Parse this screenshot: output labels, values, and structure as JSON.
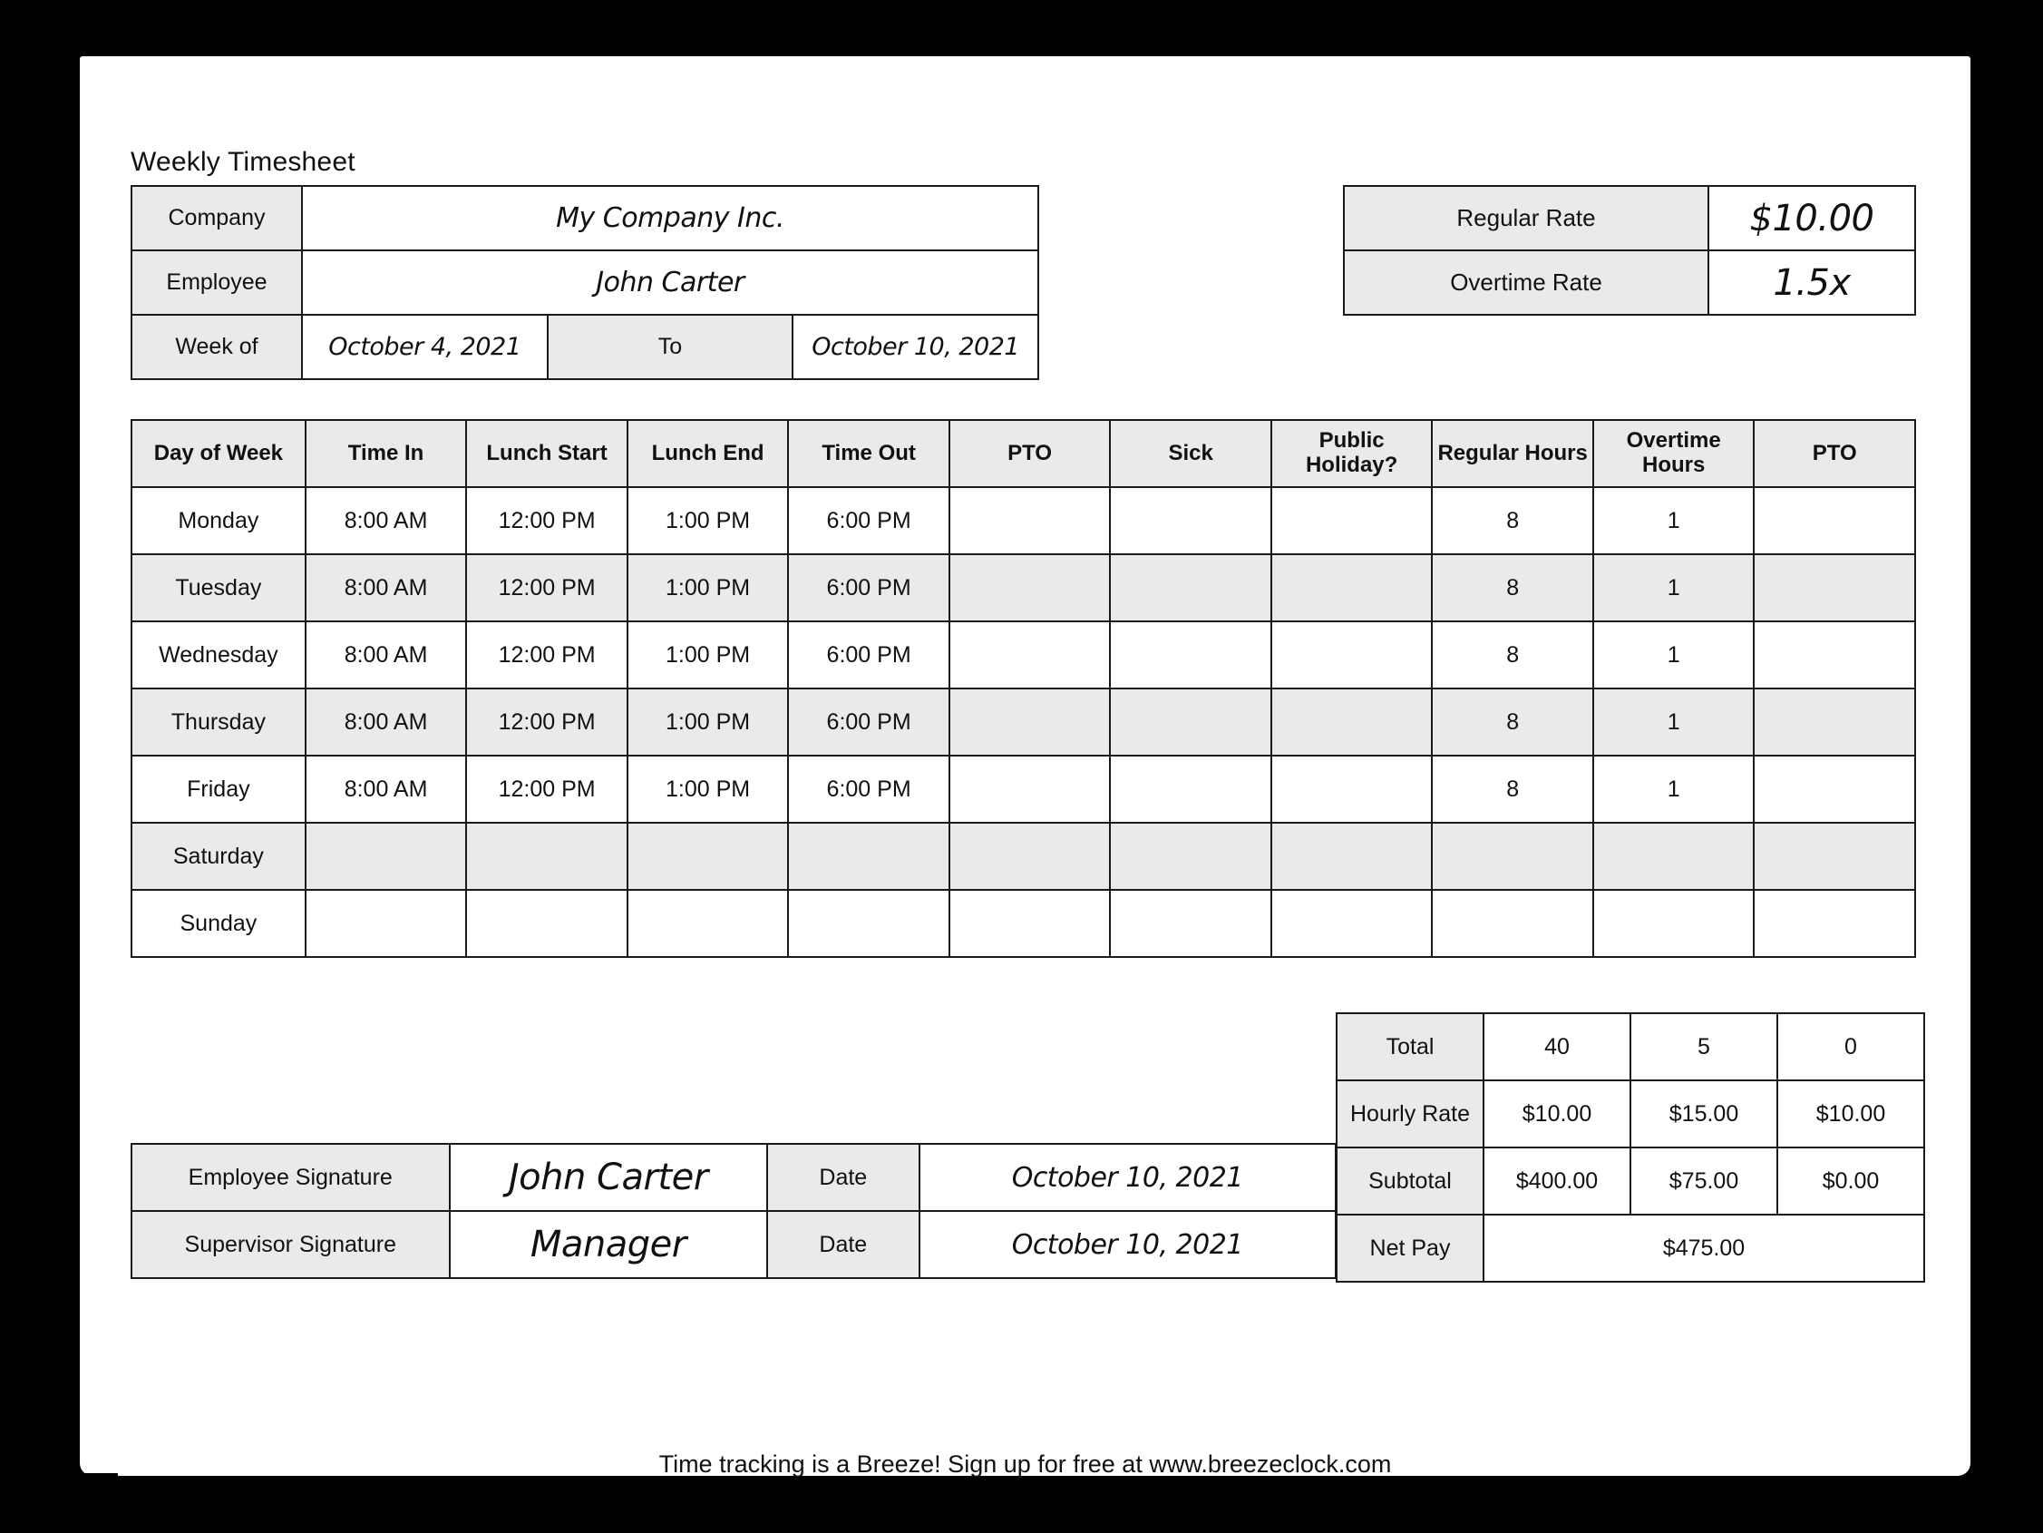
{
  "document": {
    "title": "Weekly Timesheet",
    "footer": "Time tracking is a Breeze! Sign up for free at www.breezeclock.com",
    "accent_color": "#0f74c8",
    "shade_color": "#eaeaea",
    "border_color": "#1a1a1a"
  },
  "info": {
    "company_label": "Company",
    "company_value": "My Company Inc.",
    "employee_label": "Employee",
    "employee_value": "John Carter",
    "week_of_label": "Week of",
    "week_start": "October 4, 2021",
    "to_label": "To",
    "week_end": "October 10, 2021"
  },
  "rates": {
    "regular_label": "Regular Rate",
    "regular_value": "$10.00",
    "overtime_label": "Overtime Rate",
    "overtime_value": "1.5x"
  },
  "timesheet": {
    "headers": [
      "Day of Week",
      "Time In",
      "Lunch Start",
      "Lunch End",
      "Time Out",
      "PTO",
      "Sick",
      "Public Holiday?",
      "Regular Hours",
      "Overtime Hours",
      "PTO"
    ],
    "rows": [
      {
        "day": "Monday",
        "time_in": "8:00 AM",
        "lunch_start": "12:00 PM",
        "lunch_end": "1:00 PM",
        "time_out": "6:00 PM",
        "pto": "",
        "sick": "",
        "public_holiday": "",
        "regular_hours": "8",
        "overtime_hours": "1",
        "pto_hours": ""
      },
      {
        "day": "Tuesday",
        "time_in": "8:00 AM",
        "lunch_start": "12:00 PM",
        "lunch_end": "1:00 PM",
        "time_out": "6:00 PM",
        "pto": "",
        "sick": "",
        "public_holiday": "",
        "regular_hours": "8",
        "overtime_hours": "1",
        "pto_hours": ""
      },
      {
        "day": "Wednesday",
        "time_in": "8:00 AM",
        "lunch_start": "12:00 PM",
        "lunch_end": "1:00 PM",
        "time_out": "6:00 PM",
        "pto": "",
        "sick": "",
        "public_holiday": "",
        "regular_hours": "8",
        "overtime_hours": "1",
        "pto_hours": ""
      },
      {
        "day": "Thursday",
        "time_in": "8:00 AM",
        "lunch_start": "12:00 PM",
        "lunch_end": "1:00 PM",
        "time_out": "6:00 PM",
        "pto": "",
        "sick": "",
        "public_holiday": "",
        "regular_hours": "8",
        "overtime_hours": "1",
        "pto_hours": ""
      },
      {
        "day": "Friday",
        "time_in": "8:00 AM",
        "lunch_start": "12:00 PM",
        "lunch_end": "1:00 PM",
        "time_out": "6:00 PM",
        "pto": "",
        "sick": "",
        "public_holiday": "",
        "regular_hours": "8",
        "overtime_hours": "1",
        "pto_hours": ""
      },
      {
        "day": "Saturday",
        "time_in": "",
        "lunch_start": "",
        "lunch_end": "",
        "time_out": "",
        "pto": "",
        "sick": "",
        "public_holiday": "",
        "regular_hours": "",
        "overtime_hours": "",
        "pto_hours": ""
      },
      {
        "day": "Sunday",
        "time_in": "",
        "lunch_start": "",
        "lunch_end": "",
        "time_out": "",
        "pto": "",
        "sick": "",
        "public_holiday": "",
        "regular_hours": "",
        "overtime_hours": "",
        "pto_hours": ""
      }
    ]
  },
  "totals": {
    "total_label": "Total",
    "total_regular": "40",
    "total_overtime": "5",
    "total_pto": "0",
    "rate_label": "Hourly Rate",
    "rate_regular": "$10.00",
    "rate_overtime": "$15.00",
    "rate_pto": "$10.00",
    "subtotal_label": "Subtotal",
    "subtotal_regular": "$400.00",
    "subtotal_overtime": "$75.00",
    "subtotal_pto": "$0.00",
    "net_pay_label": "Net Pay",
    "net_pay_value": "$475.00"
  },
  "signatures": {
    "employee_label": "Employee Signature",
    "employee_signature": "John Carter",
    "employee_date_label": "Date",
    "employee_date": "October 10, 2021",
    "supervisor_label": "Supervisor Signature",
    "supervisor_signature": "Manager",
    "supervisor_date_label": "Date",
    "supervisor_date": "October 10, 2021"
  }
}
